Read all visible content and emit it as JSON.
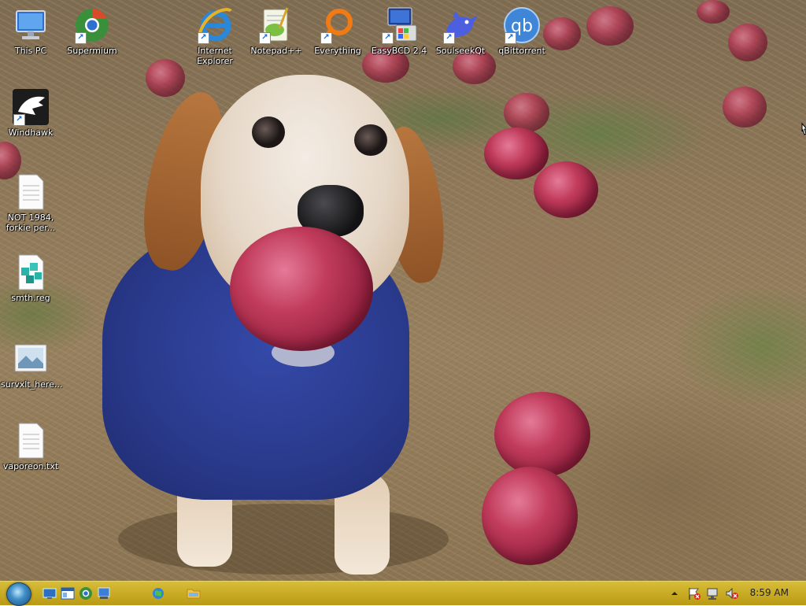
{
  "desktop": {
    "icons": [
      {
        "label": "This PC",
        "icon": "computer-icon"
      },
      {
        "label": "Supermium",
        "icon": "browser-icon"
      },
      {
        "label": "Internet Explorer",
        "icon": "ie-icon"
      },
      {
        "label": "Notepad++",
        "icon": "notepad-icon"
      },
      {
        "label": "Everything",
        "icon": "search-ring-icon"
      },
      {
        "label": "EasyBCD 2.4",
        "icon": "boot-icon"
      },
      {
        "label": "SoulseekQt",
        "icon": "bird-icon"
      },
      {
        "label": "qBittorrent",
        "icon": "qb-icon"
      },
      {
        "label": "Windhawk",
        "icon": "eagle-icon"
      },
      {
        "label": "NOT 1984, forkie per...",
        "icon": "text-file-icon"
      },
      {
        "label": "smth.reg",
        "icon": "registry-icon"
      },
      {
        "label": "survxlt_here...",
        "icon": "image-file-icon"
      },
      {
        "label": "vaporeon.txt",
        "icon": "text-file-icon"
      }
    ]
  },
  "taskbar": {
    "clock": "8:59 AM",
    "quick_launch": [
      "desktop-icon",
      "explorer-window-icon",
      "browser-icon",
      "window-icon",
      "globe-icon",
      "folder-icon"
    ],
    "tray": [
      "chevron-up-icon",
      "action-center-flag-icon",
      "network-icon",
      "volume-muted-icon"
    ]
  },
  "colors": {
    "taskbar": "#c9ab24",
    "sweater": "#2a3a8c",
    "apple": "#c23c5c"
  }
}
